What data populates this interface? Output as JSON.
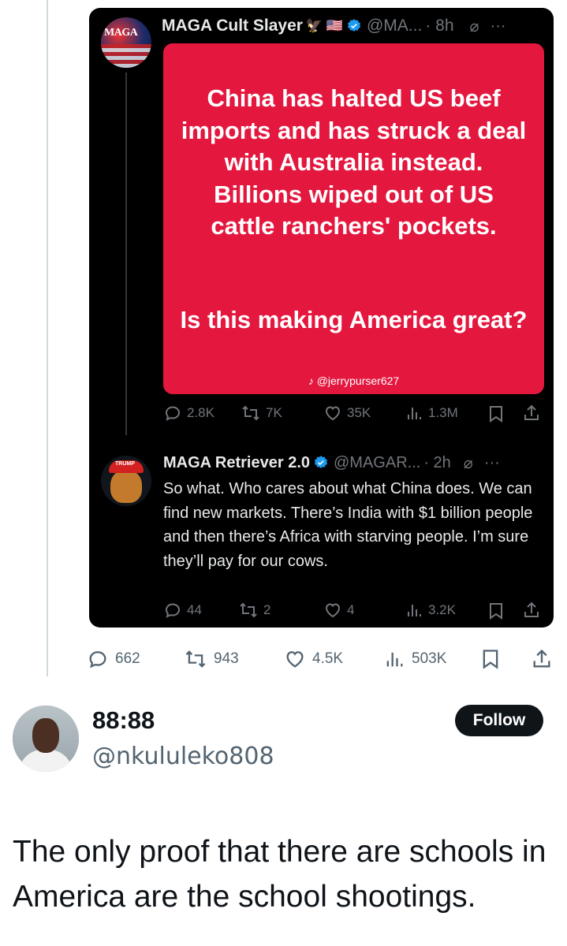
{
  "quoted_post": {
    "author_name": "MAGA Cult Slayer",
    "author_emoji": "🦅 🇺🇸",
    "handle": "@MA...",
    "time": "· 8h",
    "avatar_text": "MAGA",
    "image_text_1": "China has halted US beef imports and has struck a deal with Australia instead. Billions wiped out of US cattle ranchers' pockets.",
    "image_text_2": "Is this making America great?",
    "watermark": "@jerrypurser627",
    "replies": "2.8K",
    "reposts": "7K",
    "likes": "35K",
    "views": "1.3M"
  },
  "reply_post": {
    "author_name": "MAGA Retriever 2.0",
    "handle": "@MAGAR...",
    "time": "· 2h",
    "avatar_hat_text": "TRUMP",
    "text": "So what. Who cares about what China does. We can find new markets. There’s India with $1 billion people and then there’s Africa with starving people. I’m sure they’ll pay for our cows.",
    "replies": "44",
    "reposts": "2",
    "likes": "4",
    "views": "3.2K"
  },
  "outer_actions": {
    "replies": "662",
    "reposts": "943",
    "likes": "4.5K",
    "views": "503K"
  },
  "profile": {
    "display_name": "88:88",
    "handle": "@nkululeko808",
    "follow_label": "Follow"
  },
  "tweet": {
    "text": "The only proof that there are schools in America are the school shootings."
  },
  "colors": {
    "card_bg": "#000000",
    "red_box": "#e4173e",
    "verified": "#1d9bf0",
    "muted": "#71767b"
  }
}
